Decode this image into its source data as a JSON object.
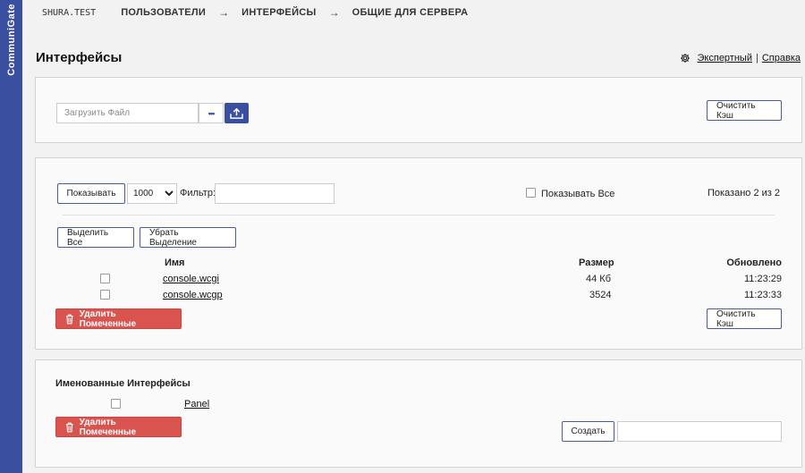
{
  "brand": "CommuniGate",
  "header": {
    "domain": "SHURA.TEST",
    "breadcrumbs": [
      "ПОЛЬЗОВАТЕЛИ",
      "ИНТЕРФЕЙСЫ",
      "ОБЩИЕ ДЛЯ СЕРВЕРА"
    ],
    "arrow": "→"
  },
  "page": {
    "title": "Интерфейсы",
    "expert_link": "Экспертный",
    "separator": "|",
    "help_link": "Справка"
  },
  "upload": {
    "placeholder": "Загрузить Файл",
    "browse_label": "•••",
    "clear_cache": "Очистить Кэш"
  },
  "files": {
    "show_button": "Показывать",
    "page_size": "1000",
    "page_size_options": [
      "1000"
    ],
    "filter_label": "Фильтр:",
    "filter_value": "",
    "show_all_label": "Показывать Все",
    "shown_count": "Показано 2 из 2",
    "select_all": "Выделить Все",
    "deselect": "Убрать Выделение",
    "columns": {
      "name": "Имя",
      "size": "Размер",
      "updated": "Обновлено"
    },
    "rows": [
      {
        "name": "console.wcgi",
        "size": "44 Кб",
        "updated": "11:23:29"
      },
      {
        "name": "console.wcgp",
        "size": "3524",
        "updated": "11:23:33"
      }
    ],
    "delete_marked": "Удалить Помеченные",
    "clear_cache": "Очистить Кэш"
  },
  "named": {
    "title": "Именованные Интерфейсы",
    "items": [
      {
        "name": "Panel"
      }
    ],
    "delete_marked": "Удалить Помеченные",
    "create": "Создать",
    "new_name_value": ""
  },
  "colors": {
    "sidebar": "#3a4f9f",
    "accent": "#3a4f9f",
    "danger": "#d9534f",
    "background": "#f2f2f2",
    "panel": "#fafafa"
  }
}
